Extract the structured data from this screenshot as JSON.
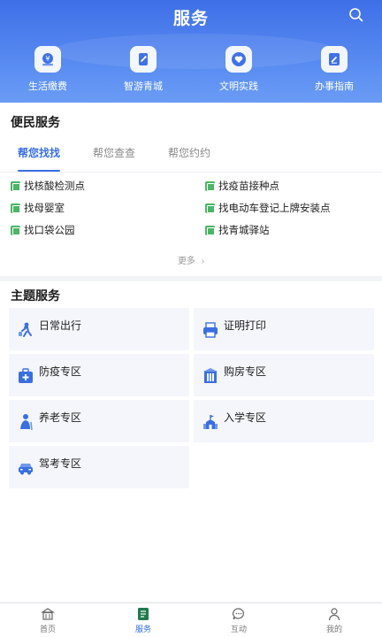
{
  "header": {
    "title": "服务",
    "quick_links": [
      {
        "label": "生活缴费",
        "icon": "payment-icon"
      },
      {
        "label": "智游青城",
        "icon": "travel-icon"
      },
      {
        "label": "文明实践",
        "icon": "heart-icon"
      },
      {
        "label": "办事指南",
        "icon": "guide-icon"
      }
    ]
  },
  "convenience": {
    "title": "便民服务",
    "tabs": [
      "帮您找找",
      "帮您查查",
      "帮您约约"
    ],
    "active_tab": 0,
    "links": [
      "找核酸检测点",
      "找疫苗接种点",
      "找母婴室",
      "找电动车登记上牌安装点",
      "找口袋公园",
      "找青城驿站"
    ],
    "more": "更多"
  },
  "theme": {
    "title": "主题服务",
    "cards": [
      {
        "label": "日常出行",
        "icon": "travel-person-icon"
      },
      {
        "label": "证明打印",
        "icon": "printer-icon"
      },
      {
        "label": "防疫专区",
        "icon": "medical-kit-icon"
      },
      {
        "label": "购房专区",
        "icon": "building-icon"
      },
      {
        "label": "养老专区",
        "icon": "elderly-icon"
      },
      {
        "label": "入学专区",
        "icon": "school-icon"
      },
      {
        "label": "驾考专区",
        "icon": "car-icon"
      }
    ]
  },
  "bottom_nav": {
    "items": [
      {
        "label": "首页",
        "icon": "home-icon"
      },
      {
        "label": "服务",
        "icon": "service-icon"
      },
      {
        "label": "互动",
        "icon": "chat-icon"
      },
      {
        "label": "我的",
        "icon": "profile-icon"
      }
    ],
    "active": 1
  },
  "colors": {
    "primary": "#3b6fe6",
    "link_icon": "#4cb567",
    "theme_icon": "#3a6fe0"
  }
}
